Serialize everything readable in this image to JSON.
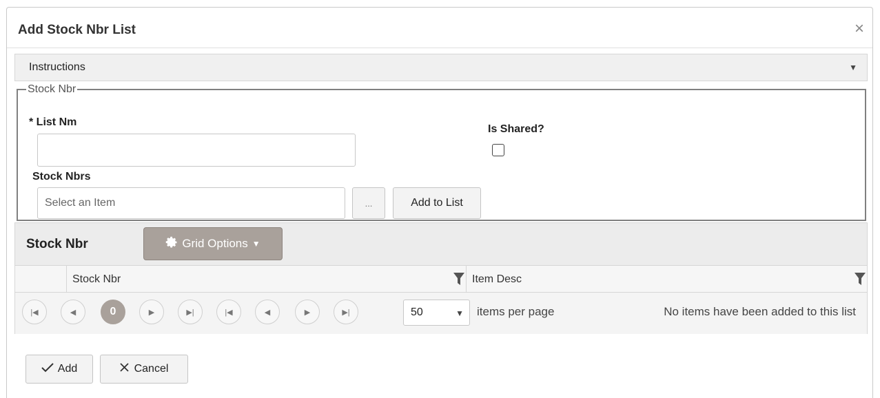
{
  "dialog": {
    "title": "Add Stock Nbr List",
    "close_glyph": "×"
  },
  "instructions": {
    "label": "Instructions",
    "toggle_glyph": "▼"
  },
  "fieldset": {
    "legend": "Stock Nbr",
    "list_nm": {
      "label": "* List Nm",
      "value": ""
    },
    "is_shared": {
      "label": "Is Shared?",
      "checked": false
    },
    "stock_nbrs": {
      "label": "Stock Nbrs",
      "placeholder": "Select an Item",
      "value": ""
    },
    "browse_label": "...",
    "add_to_list_label": "Add to List"
  },
  "grid": {
    "title": "Stock Nbr",
    "options_label": "Grid Options",
    "options_icon": "gear-icon",
    "columns": [
      {
        "label": "Stock Nbr",
        "filterable": true
      },
      {
        "label": "Item Desc",
        "filterable": true
      }
    ],
    "pager": {
      "current_page": "0",
      "page_size": "50",
      "items_per_page_label": "items per page",
      "status": "No items have been added to this list"
    }
  },
  "footer": {
    "add_label": "Add",
    "cancel_label": "Cancel"
  },
  "colors": {
    "accent": "#a9a19b",
    "header_bg": "#ececec",
    "border": "#d6d6d6"
  }
}
